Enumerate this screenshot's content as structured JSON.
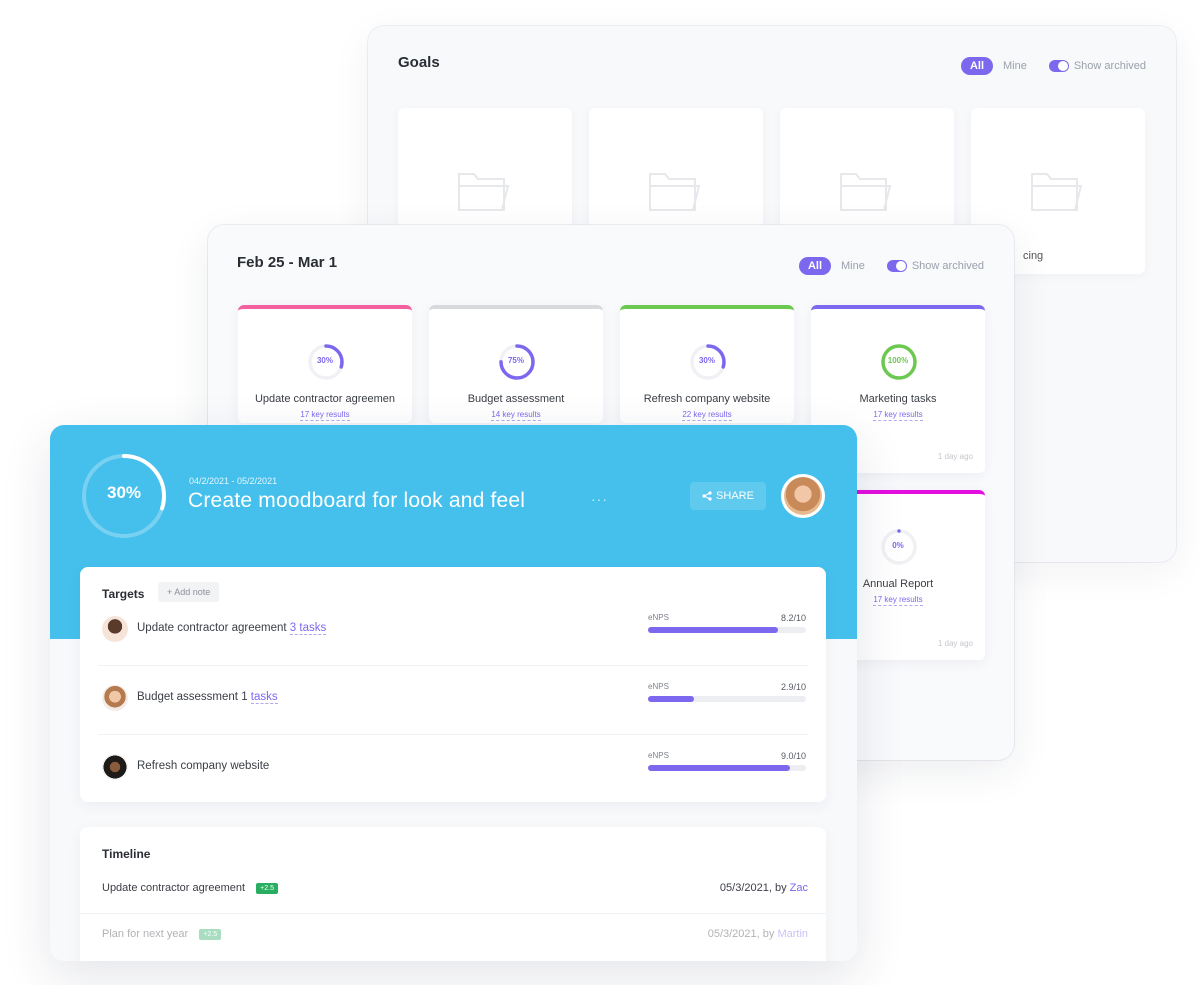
{
  "goals_panel": {
    "title": "Goals",
    "filter": {
      "all_label": "All",
      "mine_label": "Mine",
      "archived_label": "Show archived",
      "archived_on": true
    },
    "folders": [
      {
        "icon": "folder-icon",
        "name": ""
      },
      {
        "icon": "folder-icon",
        "name": ""
      },
      {
        "icon": "folder-icon",
        "name": ""
      },
      {
        "icon": "folder-icon",
        "name": "cing"
      }
    ]
  },
  "week_panel": {
    "title": "Feb 25 - Mar 1",
    "filter": {
      "all_label": "All",
      "mine_label": "Mine",
      "archived_label": "Show archived",
      "archived_on": true
    },
    "goals": [
      {
        "percent_label": "30%",
        "progress": 0.3,
        "name": "Update contractor agreemen",
        "key_results": "17 key results",
        "color": "#f2619d",
        "ring_color": "#7b68ee",
        "ago": ""
      },
      {
        "percent_label": "75%",
        "progress": 0.75,
        "name": "Budget assessment",
        "key_results": "14 key results",
        "color": "#d8d9dd",
        "ring_color": "#7b68ee",
        "ago": ""
      },
      {
        "percent_label": "30%",
        "progress": 0.3,
        "name": "Refresh company website",
        "key_results": "22 key results",
        "color": "#6bc950",
        "ring_color": "#7b68ee",
        "ago": ""
      },
      {
        "percent_label": "100%",
        "progress": 1.0,
        "name": "Marketing tasks",
        "key_results": "17 key results",
        "color": "#7b68ee",
        "ring_color": "#6bc950",
        "ago": "1 day ago"
      },
      {
        "percent_label": "0%",
        "progress": 0.0,
        "name": "Annual Report",
        "key_results": "17 key results",
        "color": "#e40ee0",
        "ring_color": "#7b68ee",
        "ago": "1 day ago"
      }
    ]
  },
  "goal_detail": {
    "progress_label": "30%",
    "progress": 0.3,
    "dates": "04/2/2021 - 05/2/2021",
    "title": "Create moodboard for look and feel",
    "more_label": "···",
    "share_label": "SHARE",
    "hero_color": "#45c0ec",
    "targets": {
      "title": "Targets",
      "add_note_label": "+ Add note",
      "items": [
        {
          "name": "Update contractor agreement",
          "tasks_link": "3 tasks",
          "metric": "eNPS",
          "value_label": "8.2/10",
          "value": 8.2,
          "max": 10
        },
        {
          "name": "Budget assessment 1",
          "tasks_link": "tasks",
          "metric": "eNPS",
          "value_label": "2.9/10",
          "value": 2.9,
          "max": 10
        },
        {
          "name": "Refresh company website",
          "tasks_link": "",
          "metric": "eNPS",
          "value_label": "9.0/10",
          "value": 9.0,
          "max": 10
        }
      ]
    },
    "timeline": {
      "title": "Timeline",
      "items": [
        {
          "name": "Update contractor agreement",
          "delta": "+2.5",
          "date": "05/3/2021, by ",
          "author": "Zac"
        },
        {
          "name": "Plan for next year",
          "delta": "+2.5",
          "date": "05/3/2021, by ",
          "author": "Martin"
        }
      ]
    }
  }
}
